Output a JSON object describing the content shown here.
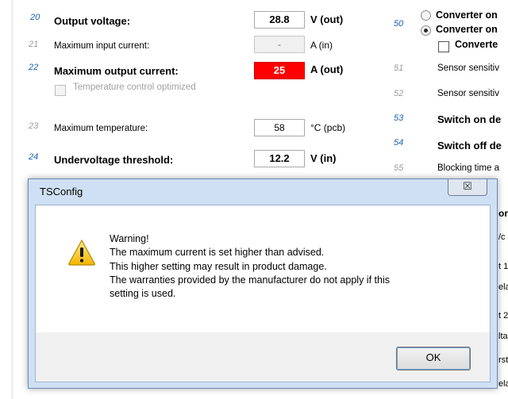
{
  "left_panel": {
    "rows": [
      {
        "num": "20",
        "label": "Output voltage:",
        "value": "28.8",
        "unit": "V (out)"
      },
      {
        "num": "21",
        "label": "Maximum input current:",
        "value": "-",
        "unit": "A (in)"
      },
      {
        "num": "22",
        "label": "Maximum output current:",
        "value": "25",
        "unit": "A (out)"
      },
      {
        "num": "23",
        "label": "Maximum temperature:",
        "value": "58",
        "unit": "°C (pcb)"
      },
      {
        "num": "24",
        "label": "Undervoltage threshold:",
        "value": "12.2",
        "unit": "V (in)"
      }
    ],
    "temp_checkbox_label": "Temperature control optimized"
  },
  "right_panel": {
    "num_50": "50",
    "radio_1": "Converter on",
    "radio_2": "Converter on",
    "checkbox_label": "Converte",
    "rows": [
      {
        "num": "51",
        "label": "Sensor sensitiv"
      },
      {
        "num": "52",
        "label": "Sensor sensitiv"
      },
      {
        "num": "53",
        "label": "Switch on de"
      },
      {
        "num": "54",
        "label": "Switch off de"
      },
      {
        "num": "55",
        "label": "Blocking time a"
      }
    ],
    "edge_fragments": [
      "or",
      "/c",
      "t 1",
      "ela",
      "t 2",
      "lta",
      "rst",
      "ela"
    ]
  },
  "dialog": {
    "title": "TSConfig",
    "close_glyph": "☒",
    "message": "Warning!\nThe maximum current is set higher than advised.\nThis higher setting may result in product damage.\nThe warranties provided by the manufacturer do not apply if this\nsetting is used.",
    "ok_label": "OK"
  },
  "colors": {
    "accent_num": "#1c5fb7",
    "alert": "#ff0000",
    "dialog_frame": "#cfe0f4"
  }
}
